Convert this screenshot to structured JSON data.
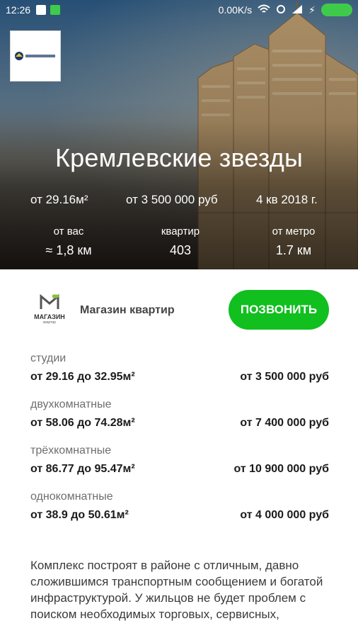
{
  "status_bar": {
    "time": "12:26",
    "network_speed": "0.00K/s",
    "icons": [
      "wifi-icon",
      "signal-icon",
      "battery-icon"
    ]
  },
  "hero": {
    "title": "Кремлевские звезды",
    "stats": {
      "area": "от 29.16м²",
      "price": "от 3 500 000 руб",
      "deadline": "4 кв 2018 г."
    },
    "metrics": [
      {
        "label": "от вас",
        "value": "≈ 1,8 км"
      },
      {
        "label": "квартир",
        "value": "403"
      },
      {
        "label": "от метро",
        "value": "1.7 км"
      }
    ]
  },
  "seller": {
    "logo_text": "МАГАЗИН",
    "logo_subtext": "квартир",
    "name": "Магазин квартир",
    "call_label": "ПОЗВОНИТЬ"
  },
  "listings": [
    {
      "category": "студии",
      "range": "от 29.16 до 32.95м²",
      "price": "от 3 500 000 руб"
    },
    {
      "category": "двухкомнатные",
      "range": "от 58.06 до 74.28м²",
      "price": "от 7 400 000 руб"
    },
    {
      "category": "трёхкомнатные",
      "range": "от 86.77 до 95.47м²",
      "price": "от 10 900 000 руб"
    },
    {
      "category": "однокомнатные",
      "range": "от 38.9 до 50.61м²",
      "price": "от 4 000 000 руб"
    }
  ],
  "description": "Комплекс построят в районе с отличным, давно сложившимся транспортным сообщением и богатой инфраструктурой. У жильцов не будет проблем с поиском необходимых торговых, сервисных,",
  "colors": {
    "accent": "#11bf1f",
    "status_green": "#3ecb4a"
  }
}
